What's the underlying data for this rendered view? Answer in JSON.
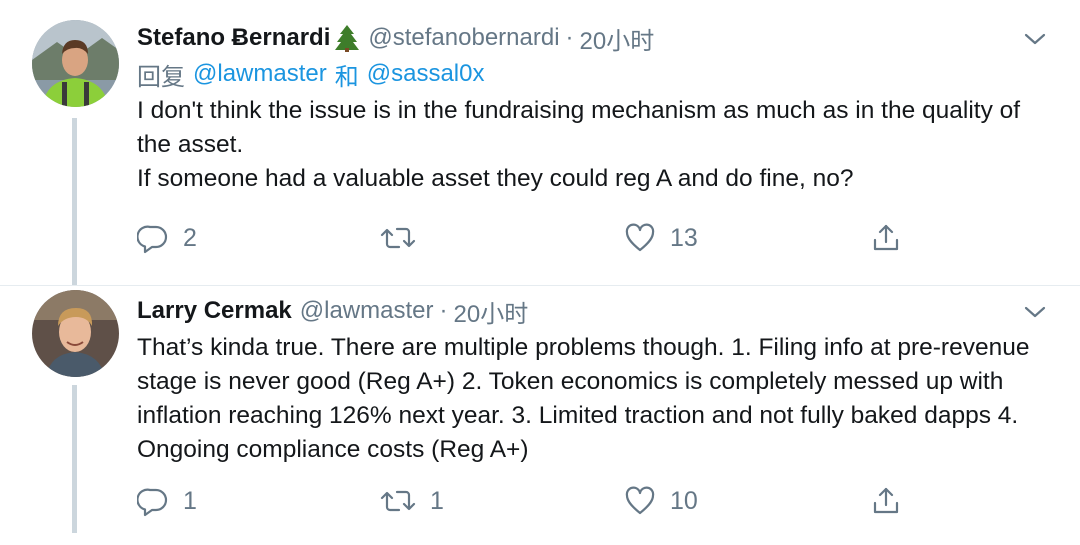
{
  "tweets": [
    {
      "display_name": "Stefano Ƀernardi",
      "name_emoji": "evergreen-tree-emoji",
      "handle": "@stefanobernardi",
      "separator": "·",
      "timestamp": "20小时",
      "reply_to": {
        "prefix": "回复",
        "handles": [
          "@lawmaster",
          "@sassal0x"
        ],
        "conjunction": "和"
      },
      "body": [
        "I don't think the issue is in the fundraising mechanism as much as in the quality of the asset.",
        "If someone had a valuable asset they could reg A and do fine, no?"
      ],
      "stats": {
        "replies": "2",
        "retweets": "",
        "likes": "13"
      },
      "has_thread_line": true
    },
    {
      "display_name": "Larry Cermak",
      "handle": "@lawmaster",
      "separator": "·",
      "timestamp": "20小时",
      "body": [
        "That’s kinda true. There are multiple problems though. 1. Filing info at pre-revenue stage is never good (Reg A+) 2. Token economics is completely messed up with inflation reaching 126% next year. 3. Limited traction and not fully baked dapps 4. Ongoing compliance costs (Reg A+)"
      ],
      "stats": {
        "replies": "1",
        "retweets": "1",
        "likes": "10"
      },
      "has_thread_line": true
    }
  ],
  "icons": {
    "reply": "reply-icon",
    "retweet": "retweet-icon",
    "like": "heart-icon",
    "share": "share-icon",
    "caret": "chevron-down-icon"
  },
  "colors": {
    "text": "#14171a",
    "secondary": "#657786",
    "link": "#1b95e0",
    "thread_line": "#ccd6dd",
    "divider": "#e6ecf0"
  }
}
